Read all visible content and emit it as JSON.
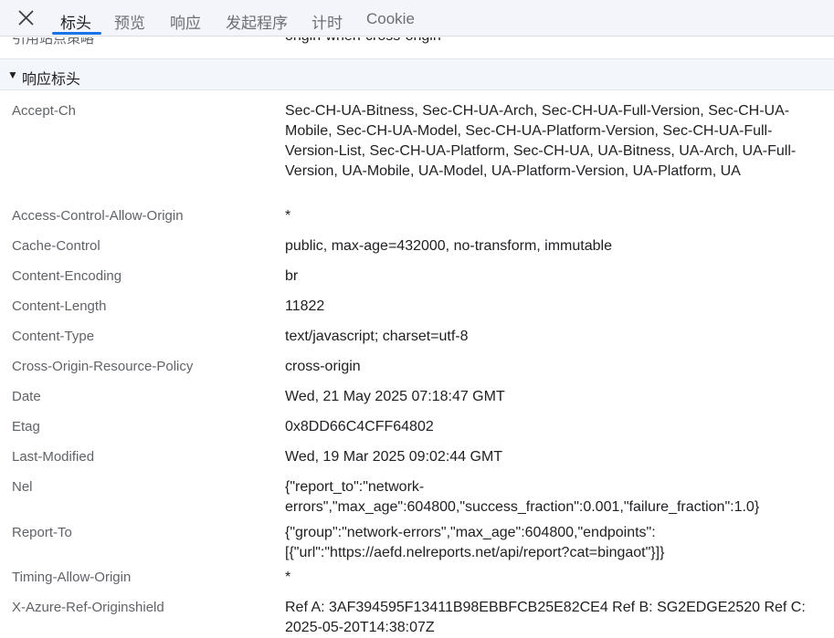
{
  "tabs": [
    {
      "label": "标头"
    },
    {
      "label": "预览"
    },
    {
      "label": "响应"
    },
    {
      "label": "发起程序"
    },
    {
      "label": "计时"
    },
    {
      "label": "Cookie"
    }
  ],
  "previous_row": {
    "name": "引用站点策略",
    "value": "origin-when-cross-origin"
  },
  "section": {
    "title": "响应标头"
  },
  "headers": [
    {
      "name": "Accept-Ch",
      "value": "Sec-CH-UA-Bitness, Sec-CH-UA-Arch, Sec-CH-UA-Full-Version, Sec-CH-UA-Mobile, Sec-CH-UA-Model, Sec-CH-UA-Platform-Version, Sec-CH-UA-Full-Version-List, Sec-CH-UA-Platform, Sec-CH-UA, UA-Bitness, UA-Arch, UA-Full-Version, UA-Mobile, UA-Model, UA-Platform-Version, UA-Platform, UA"
    },
    {
      "name": "Access-Control-Allow-Origin",
      "value": "*"
    },
    {
      "name": "Cache-Control",
      "value": "public, max-age=432000, no-transform, immutable"
    },
    {
      "name": "Content-Encoding",
      "value": "br"
    },
    {
      "name": "Content-Length",
      "value": "11822"
    },
    {
      "name": "Content-Type",
      "value": "text/javascript; charset=utf-8"
    },
    {
      "name": "Cross-Origin-Resource-Policy",
      "value": "cross-origin"
    },
    {
      "name": "Date",
      "value": "Wed, 21 May 2025 07:18:47 GMT"
    },
    {
      "name": "Etag",
      "value": "0x8DD66C4CFF64802"
    },
    {
      "name": "Last-Modified",
      "value": "Wed, 19 Mar 2025 09:02:44 GMT"
    },
    {
      "name": "Nel",
      "value": "{\"report_to\":\"network-errors\",\"max_age\":604800,\"success_fraction\":0.001,\"failure_fraction\":1.0}"
    },
    {
      "name": "Report-To",
      "value": "{\"group\":\"network-errors\",\"max_age\":604800,\"endpoints\":[{\"url\":\"https://aefd.nelreports.net/api/report?cat=bingaot\"}]}"
    },
    {
      "name": "Timing-Allow-Origin",
      "value": "*"
    },
    {
      "name": "X-Azure-Ref-Originshield",
      "value": "Ref A: 3AF394595F13411B98EBBFCB25E82CE4 Ref B: SG2EDGE2520 Ref C: 2025-05-20T14:38:07Z"
    }
  ],
  "icons": {
    "close": "close-icon",
    "section_toggle": "triangle-down-icon"
  },
  "colors": {
    "accent": "#1a73e8",
    "tabbar_bg": "#f3f5fa",
    "section_bg": "#f3f6fb",
    "header_name": "#5f6368"
  }
}
